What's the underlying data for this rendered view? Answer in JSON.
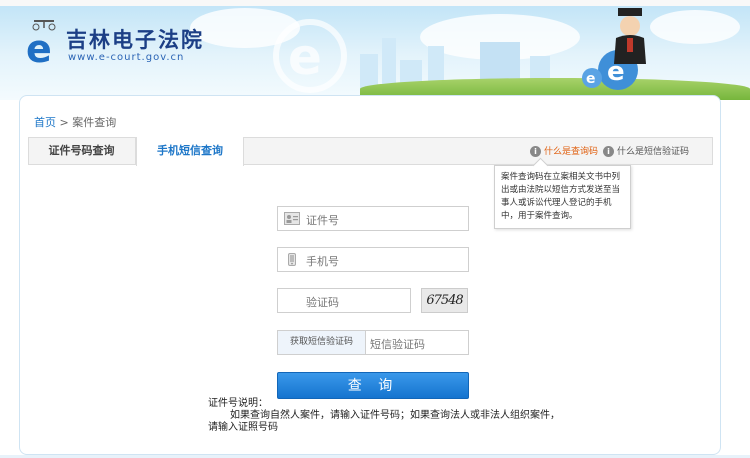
{
  "header": {
    "site_title": "吉林电子法院",
    "site_url": "www.e-court.gov.cn"
  },
  "breadcrumb": {
    "home": "首页",
    "separator": ">",
    "current": "案件查询"
  },
  "tabs": [
    {
      "label": "证件号码查询",
      "active": false
    },
    {
      "label": "手机短信查询",
      "active": true
    }
  ],
  "help": {
    "what_is_query_code": "什么是查询码",
    "what_is_sms_code": "什么是短信验证码",
    "tooltip": "案件查询码在立案相关文书中列出或由法院以短信方式发送至当事人或诉讼代理人登记的手机中，用于案件查询。"
  },
  "form": {
    "id_placeholder": "证件号",
    "phone_placeholder": "手机号",
    "captcha_placeholder": "验证码",
    "captcha_image_text": "67548",
    "get_sms_code_label": "获取短信验证码",
    "sms_code_placeholder": "短信验证码",
    "submit_label": "查 询"
  },
  "note": {
    "title": "证件号说明：",
    "line1": "如果查询自然人案件，请输入证件号码；如果查询法人或非法人组织案件，",
    "line2": "请输入证照号码"
  },
  "colors": {
    "brand_blue": "#1e77c8",
    "accent_orange": "#e06010"
  }
}
